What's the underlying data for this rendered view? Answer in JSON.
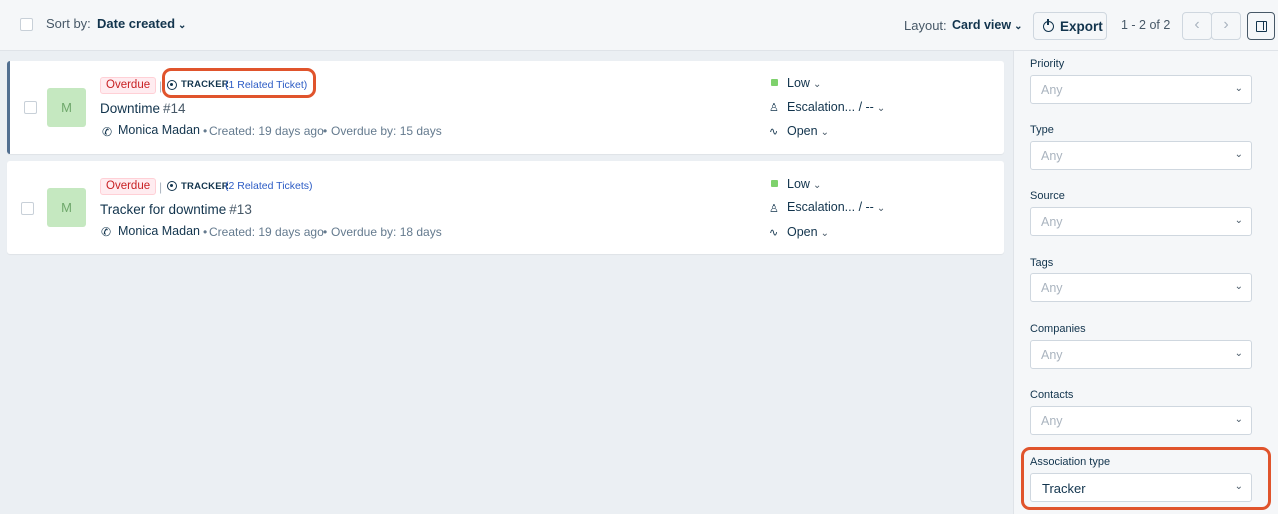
{
  "toolbar": {
    "sort_label": "Sort by:",
    "sort_value": "Date created",
    "layout_label": "Layout:",
    "layout_value": "Card view",
    "export_label": "Export",
    "pagination": "1 - 2 of 2",
    "prev_icon": "chevron-left-icon",
    "next_icon": "chevron-right-icon"
  },
  "tickets": [
    {
      "status_badge": "Overdue",
      "tracker_label": "TRACKER",
      "related_link": "(1 Related Ticket)",
      "avatar_initial": "M",
      "title": "Downtime",
      "number": "#14",
      "contact": "Monica Madan",
      "created": "Created: 19 days ago",
      "overdue": "Overdue by: 15 days",
      "priority": "Low",
      "group": "Escalation... / --",
      "status": "Open"
    },
    {
      "status_badge": "Overdue",
      "tracker_label": "TRACKER",
      "related_link": "(2 Related Tickets)",
      "avatar_initial": "M",
      "title": "Tracker for downtime",
      "number": "#13",
      "contact": "Monica Madan",
      "created": "Created: 19 days ago",
      "overdue": "Overdue by: 18 days",
      "priority": "Low",
      "group": "Escalation... / --",
      "status": "Open"
    }
  ],
  "filters": [
    {
      "label": "Priority",
      "value": "Any"
    },
    {
      "label": "Type",
      "value": "Any"
    },
    {
      "label": "Source",
      "value": "Any"
    },
    {
      "label": "Tags",
      "value": "Any"
    },
    {
      "label": "Companies",
      "value": "Any"
    },
    {
      "label": "Contacts",
      "value": "Any"
    },
    {
      "label": "Association type",
      "value": "Tracker"
    }
  ],
  "colors": {
    "accent": "#2c5cc5",
    "overdue_red": "#c82124",
    "priority_low": "#7ed16c",
    "highlight": "#e0542c"
  }
}
